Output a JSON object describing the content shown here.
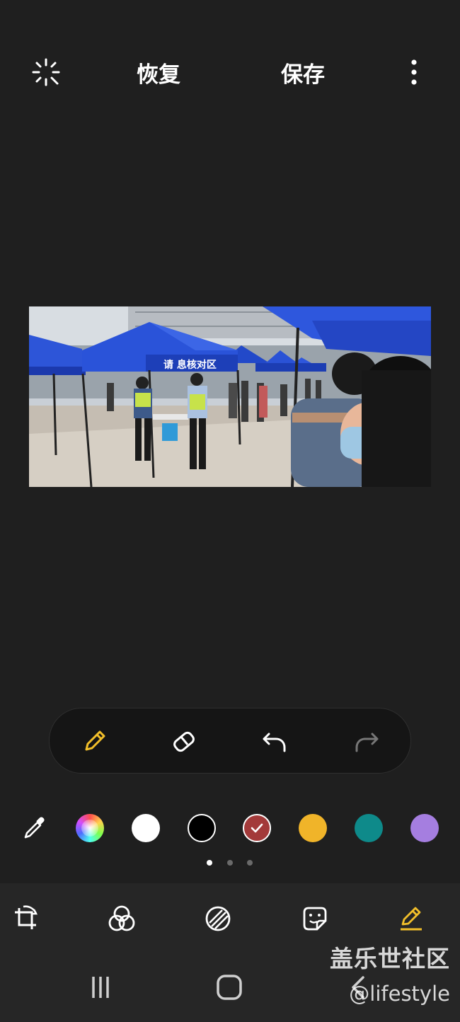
{
  "top_bar": {
    "revert_label": "恢复",
    "save_label": "保存",
    "icons": [
      "auto-enhance-icon",
      "more-options-icon"
    ]
  },
  "photo": {
    "tent_banner": "请 息核对区"
  },
  "drawing_tools": [
    {
      "name": "pen",
      "icon": "pencil-icon",
      "selected": true
    },
    {
      "name": "eraser",
      "icon": "eraser-icon",
      "selected": false
    },
    {
      "name": "undo",
      "icon": "undo-icon",
      "enabled": true
    },
    {
      "name": "redo",
      "icon": "redo-icon",
      "enabled": false
    }
  ],
  "palette": {
    "colors": [
      "#ffffff",
      "#000000",
      "#a33a3a",
      "#f0b429",
      "#0e8a8a",
      "#a57ee0"
    ],
    "selected_color": "#a33a3a",
    "page_dots": 3,
    "active_page": 1
  },
  "bottom_toolbar": [
    "transform-icon",
    "filters-icon",
    "tone-icon",
    "stickers-icon",
    "draw-icon"
  ],
  "accent_color": "#f2bf2a",
  "watermark": {
    "line1": "盖乐世社区",
    "line2": "@lifestyle"
  }
}
